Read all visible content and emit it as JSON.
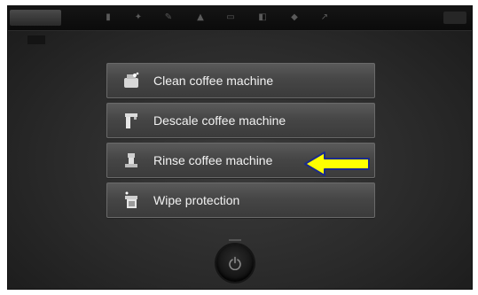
{
  "menu": {
    "items": [
      {
        "label": "Clean coffee machine",
        "icon": "clean-icon"
      },
      {
        "label": "Descale coffee machine",
        "icon": "descale-icon"
      },
      {
        "label": "Rinse coffee machine",
        "icon": "rinse-icon"
      },
      {
        "label": "Wipe protection",
        "icon": "wipe-protection-icon"
      }
    ]
  },
  "colors": {
    "arrow_fill": "#ffff00",
    "arrow_stroke": "#1a2a8c",
    "menu_text": "#f2f2f2",
    "background": "#2f2f2f"
  },
  "power_button": {
    "icon": "power-icon"
  }
}
